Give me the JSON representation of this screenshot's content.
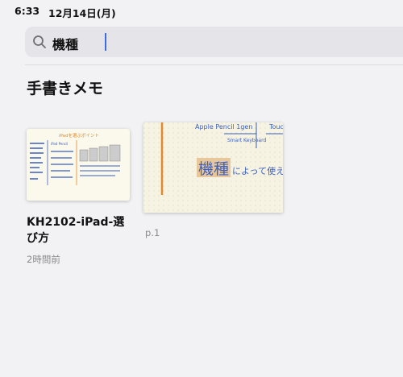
{
  "status_bar": {
    "time": "6:33",
    "date": "12月14日(月)"
  },
  "search": {
    "value": "機種"
  },
  "section": {
    "title": "手書きメモ"
  },
  "note": {
    "title": "KH2102-iPad-選び方",
    "modified": "2時間前",
    "thumbnail": {
      "heading": "iPadを選ぶポイント",
      "subheading": "iPad Pencil"
    }
  },
  "page_result": {
    "page_label": "p.1",
    "snippet": {
      "col1": "Apple Pencil 1gen",
      "col2": "Smart Keyboard",
      "col3": "Touch",
      "highlight": "機種",
      "phrase": "によって使える"
    }
  },
  "colors": {
    "background": "#f2f2f4",
    "search_field": "#e4e4e9",
    "caret": "#3a6fe0",
    "ink_blue": "#3a5fc0",
    "highlight": "#e8c79a",
    "margin_line": "#e08a2a"
  }
}
